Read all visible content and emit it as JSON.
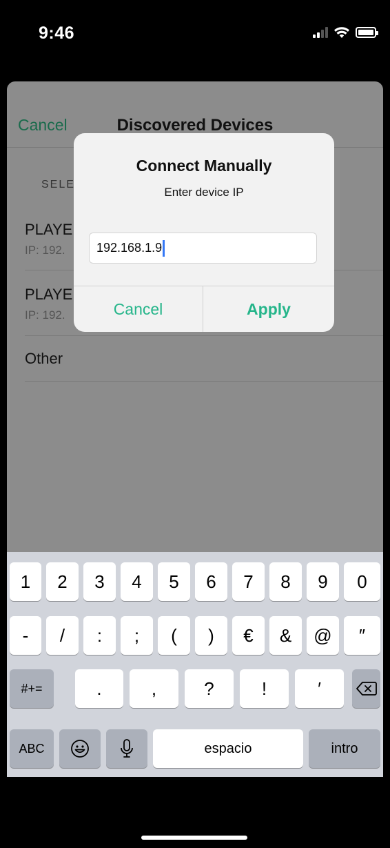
{
  "status_bar": {
    "time": "9:46"
  },
  "nav": {
    "cancel_label": "Cancel",
    "title": "Discovered Devices"
  },
  "list": {
    "section_header": "SELE",
    "items": [
      {
        "title": "PLAYE",
        "subtitle": "IP: 192."
      },
      {
        "title": "PLAYE",
        "subtitle": "IP: 192."
      },
      {
        "title": "Other",
        "subtitle": ""
      }
    ]
  },
  "dialog": {
    "title": "Connect Manually",
    "message": "Enter device IP",
    "input_value": "192.168.1.9",
    "cancel_label": "Cancel",
    "apply_label": "Apply"
  },
  "keyboard": {
    "row1": [
      "1",
      "2",
      "3",
      "4",
      "5",
      "6",
      "7",
      "8",
      "9",
      "0"
    ],
    "row2": [
      "-",
      "/",
      ":",
      ";",
      "(",
      ")",
      "€",
      "&",
      "@",
      "″"
    ],
    "row3": {
      "mode_key": "#+=",
      "keys": [
        ".",
        ",",
        "?",
        "!",
        "′"
      ]
    },
    "row4": {
      "abc_key": "ABC",
      "space_key": "espacio",
      "return_key": "intro"
    }
  },
  "colors": {
    "accent": "#25b58a",
    "nav_cancel": "#1a6b4c",
    "caret": "#3478f6"
  }
}
